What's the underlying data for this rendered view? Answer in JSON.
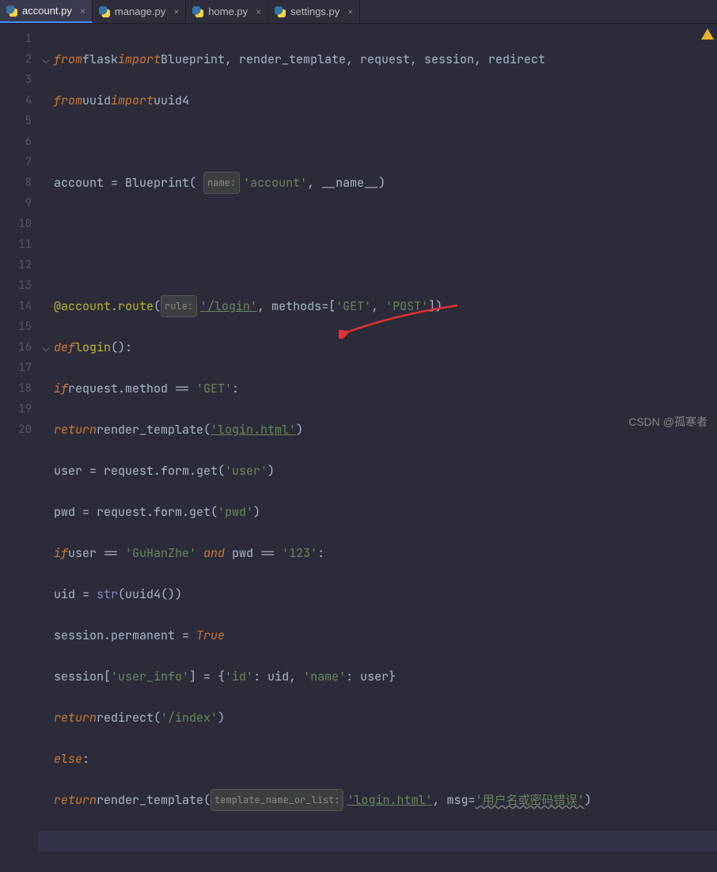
{
  "tabs": [
    {
      "label": "account.py",
      "active": true
    },
    {
      "label": "manage.py",
      "active": false
    },
    {
      "label": "home.py",
      "active": false
    },
    {
      "label": "settings.py",
      "active": false
    }
  ],
  "gutter_start": 1,
  "gutter_end": 20,
  "code": {
    "l1": {
      "from": "from",
      "mod1": "flask",
      "import": "import",
      "names": "Blueprint, render_template, request, session, redirect"
    },
    "l2": {
      "from": "from",
      "mod": "uuid",
      "import": "import",
      "name": "uuid4"
    },
    "l4": {
      "var": "account",
      "eq": " = ",
      "cls": "Blueprint",
      "hint": "name:",
      "str": "'account'",
      "rest": ", __name__)"
    },
    "l7": {
      "dec": "@account.route",
      "open": "(",
      "hint": "rule:",
      "str": "'/login'",
      "mid": ", methods=[",
      "g": "'GET'",
      "c": ", ",
      "p": "'POST'",
      "end": "])"
    },
    "l8": {
      "def": "def",
      "name": "login",
      "rest": "():"
    },
    "l9": {
      "if": "if",
      "expr": "request.method == ",
      "str": "'GET'",
      "colon": ":"
    },
    "l10": {
      "ret": "return",
      "fn": "render_template",
      "open": "(",
      "str": "'login.html'",
      "close": ")"
    },
    "l11": {
      "lhs": "user = request.form.get(",
      "str": "'user'",
      "close": ")"
    },
    "l12": {
      "lhs": "pwd = request.form.get(",
      "str": "'pwd'",
      "close": ")"
    },
    "l13": {
      "if": "if",
      "a": "user == ",
      "s1": "'GuHanZhe'",
      "and": " and ",
      "b": "pwd == ",
      "s2": "'123'",
      "colon": ":"
    },
    "l14": {
      "lhs": "uid = ",
      "fn": "str",
      "open": "(",
      "inner": "uuid4()",
      "close": ")"
    },
    "l15": {
      "lhs": "session.permanent = ",
      "val": "True"
    },
    "l16": {
      "a": "session[",
      "k": "'user_info'",
      "b": "] = {",
      "k2": "'id'",
      "c": ": uid, ",
      "k3": "'name'",
      "d": ": user}"
    },
    "l17": {
      "ret": "return",
      "fn": "redirect",
      "open": "(",
      "str": "'/index'",
      "close": ")"
    },
    "l18": {
      "else": "else",
      ":": ":"
    },
    "l19": {
      "ret": "return",
      "fn": "render_template",
      "open": "(",
      "hint": "template_name_or_list:",
      "str": "'login.html'",
      "mid": ", msg=",
      "msg": "'用户名或密码错误'",
      "close": ")"
    }
  },
  "watermark": "CSDN @孤寒者"
}
